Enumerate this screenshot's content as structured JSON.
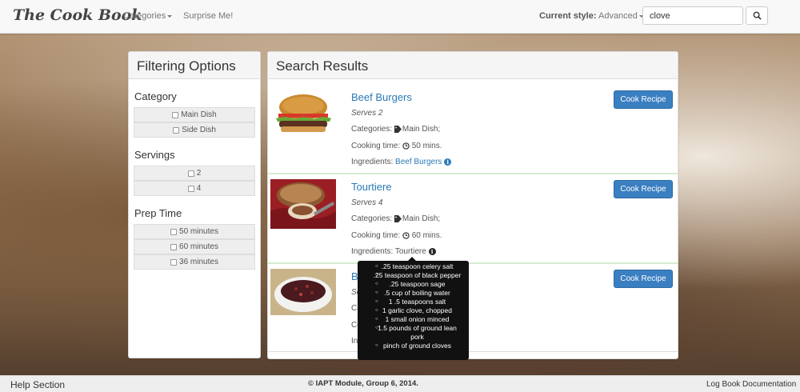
{
  "navbar": {
    "brand": "The Cook Book",
    "categories_label": "Categories",
    "surprise_label": "Surprise Me!",
    "style_prefix": "Current style:",
    "style_value": "Advanced",
    "search_value": "clove"
  },
  "filter": {
    "title": "Filtering Options",
    "category_title": "Category",
    "categories": [
      "Main Dish",
      "Side Dish"
    ],
    "servings_title": "Servings",
    "servings": [
      "2",
      "4"
    ],
    "prep_title": "Prep Time",
    "prep_times": [
      "50 minutes",
      "60 minutes",
      "36 minutes"
    ]
  },
  "results": {
    "title": "Search Results",
    "cook_label": "Cook Recipe",
    "categories_prefix": "Categories:",
    "cooking_prefix": "Cooking time:",
    "ingredients_prefix": "Ingredients:",
    "items": [
      {
        "title": "Beef Burgers",
        "serves": "Serves 2",
        "categories": "Main Dish;",
        "time": "50 mins.",
        "ingredients": "Beef Burgers"
      },
      {
        "title": "Tourtiere",
        "serves": "Serves 4",
        "categories": "Main Dish;",
        "time": "60 mins.",
        "ingredients": "Tourtiere"
      },
      {
        "title": "Black",
        "serves": "Serves 4",
        "categories": "",
        "time": "",
        "ingredients": ""
      }
    ]
  },
  "tooltip": {
    "items": [
      ".25 teaspoon celery salt",
      ".25 teaspoon of black pepper",
      ".25 teaspoon sage",
      ".5 cup of boiling water",
      "1 .5 teaspoons salt",
      "1 garlic clove, chopped",
      "1 small onion minced",
      "1.5 pounds of ground lean pork",
      "pinch of ground cloves"
    ]
  },
  "footer": {
    "help": "Help Section",
    "copyright": "© IAPT Module, Group 6, 2014.",
    "docs": "Log Book Documentation"
  },
  "colors": {
    "link": "#2a7ab8",
    "button": "#3a7fc1",
    "divider": "#d4ecd0"
  }
}
